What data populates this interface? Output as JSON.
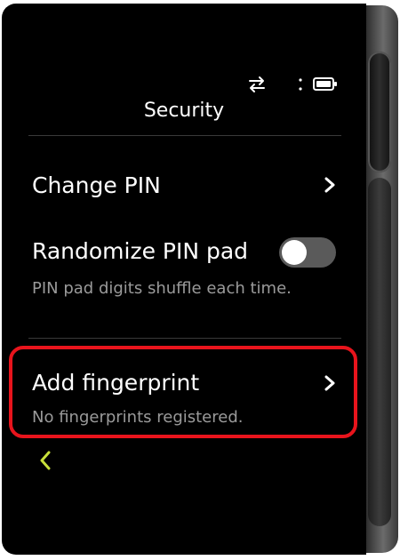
{
  "header": {
    "title": "Security"
  },
  "status_bar": {
    "icons": [
      "transfer-arrows-icon",
      "signal-dots-icon",
      "battery-icon"
    ]
  },
  "settings": [
    {
      "label": "Change PIN",
      "subtitle": "",
      "control": "chevron-right-icon"
    },
    {
      "label": "Randomize PIN pad",
      "subtitle": "PIN pad digits shuffle each time.",
      "control": "toggle",
      "toggle_on": false
    },
    {
      "label": "Add fingerprint",
      "subtitle": "No fingerprints registered.",
      "control": "chevron-right-icon",
      "highlighted": true
    }
  ],
  "footer": {
    "back_icon": "chevron-left-icon"
  },
  "colors": {
    "background": "#000000",
    "text": "#ffffff",
    "subtext": "#9a9a9a",
    "highlight": "#e8141c",
    "accent_back": "#c8e03a",
    "toggle_off": "#5a5a5a"
  }
}
